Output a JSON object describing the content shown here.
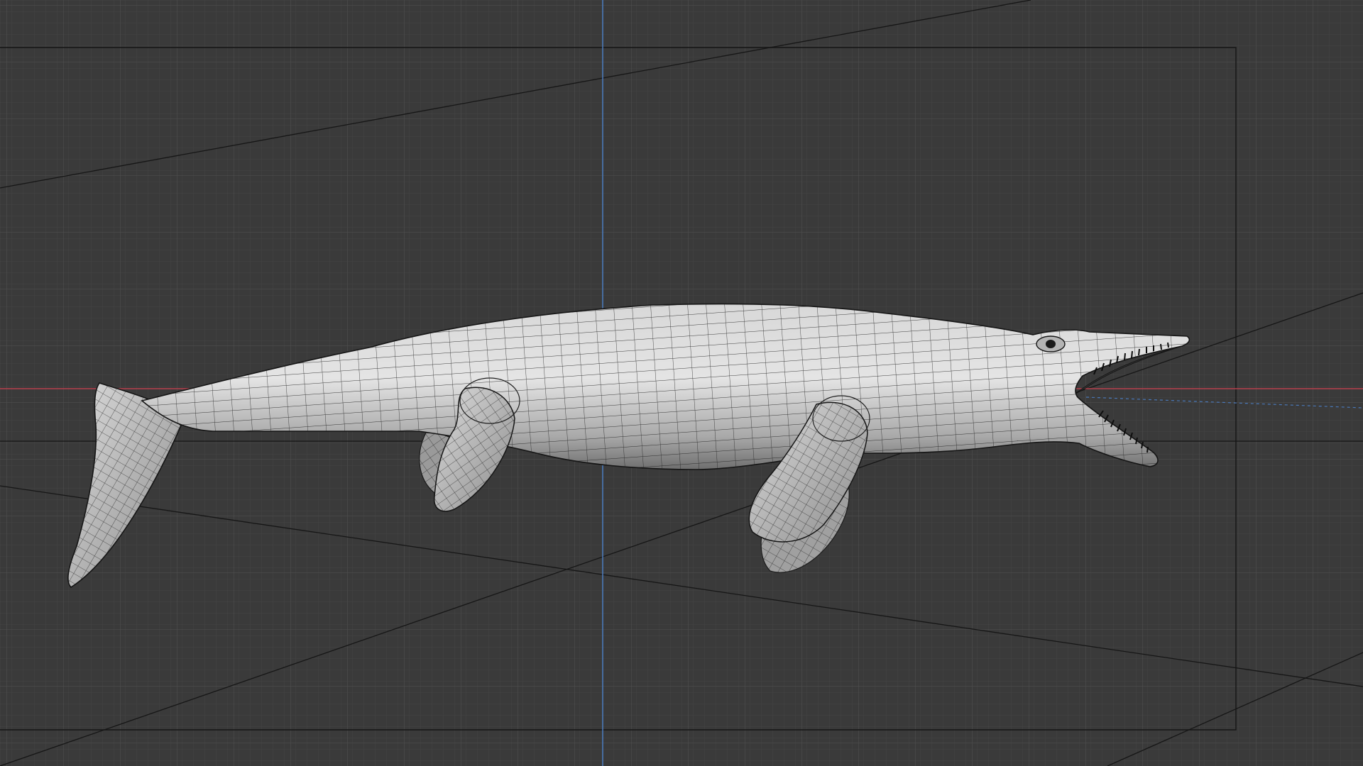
{
  "app": {
    "editor": "3d-viewport",
    "view": "orthographic-side",
    "shading": "solid-with-wireframe-overlay"
  },
  "viewport": {
    "background_color": "#3a3a3a",
    "grid_minor_color": "#434343",
    "grid_major_color": "#4b4b4b",
    "x_axis_color": "#b8404c",
    "z_axis_color": "#4a78b8",
    "camera_frame_color": "#111111",
    "overlays": [
      "grid",
      "x-axis-line",
      "z-axis-line",
      "camera-frame",
      "light-guides"
    ]
  },
  "scene": {
    "object": {
      "name_hint": "sea-reptile-mesh",
      "material_color": "#cfcfcf",
      "wire_color": "#1e1e1e",
      "parts": [
        "tail-fin",
        "body",
        "hind-flipper-left",
        "hind-flipper-right",
        "front-flipper-left",
        "front-flipper-right",
        "head",
        "upper-jaw",
        "lower-jaw",
        "eye",
        "teeth"
      ]
    }
  }
}
